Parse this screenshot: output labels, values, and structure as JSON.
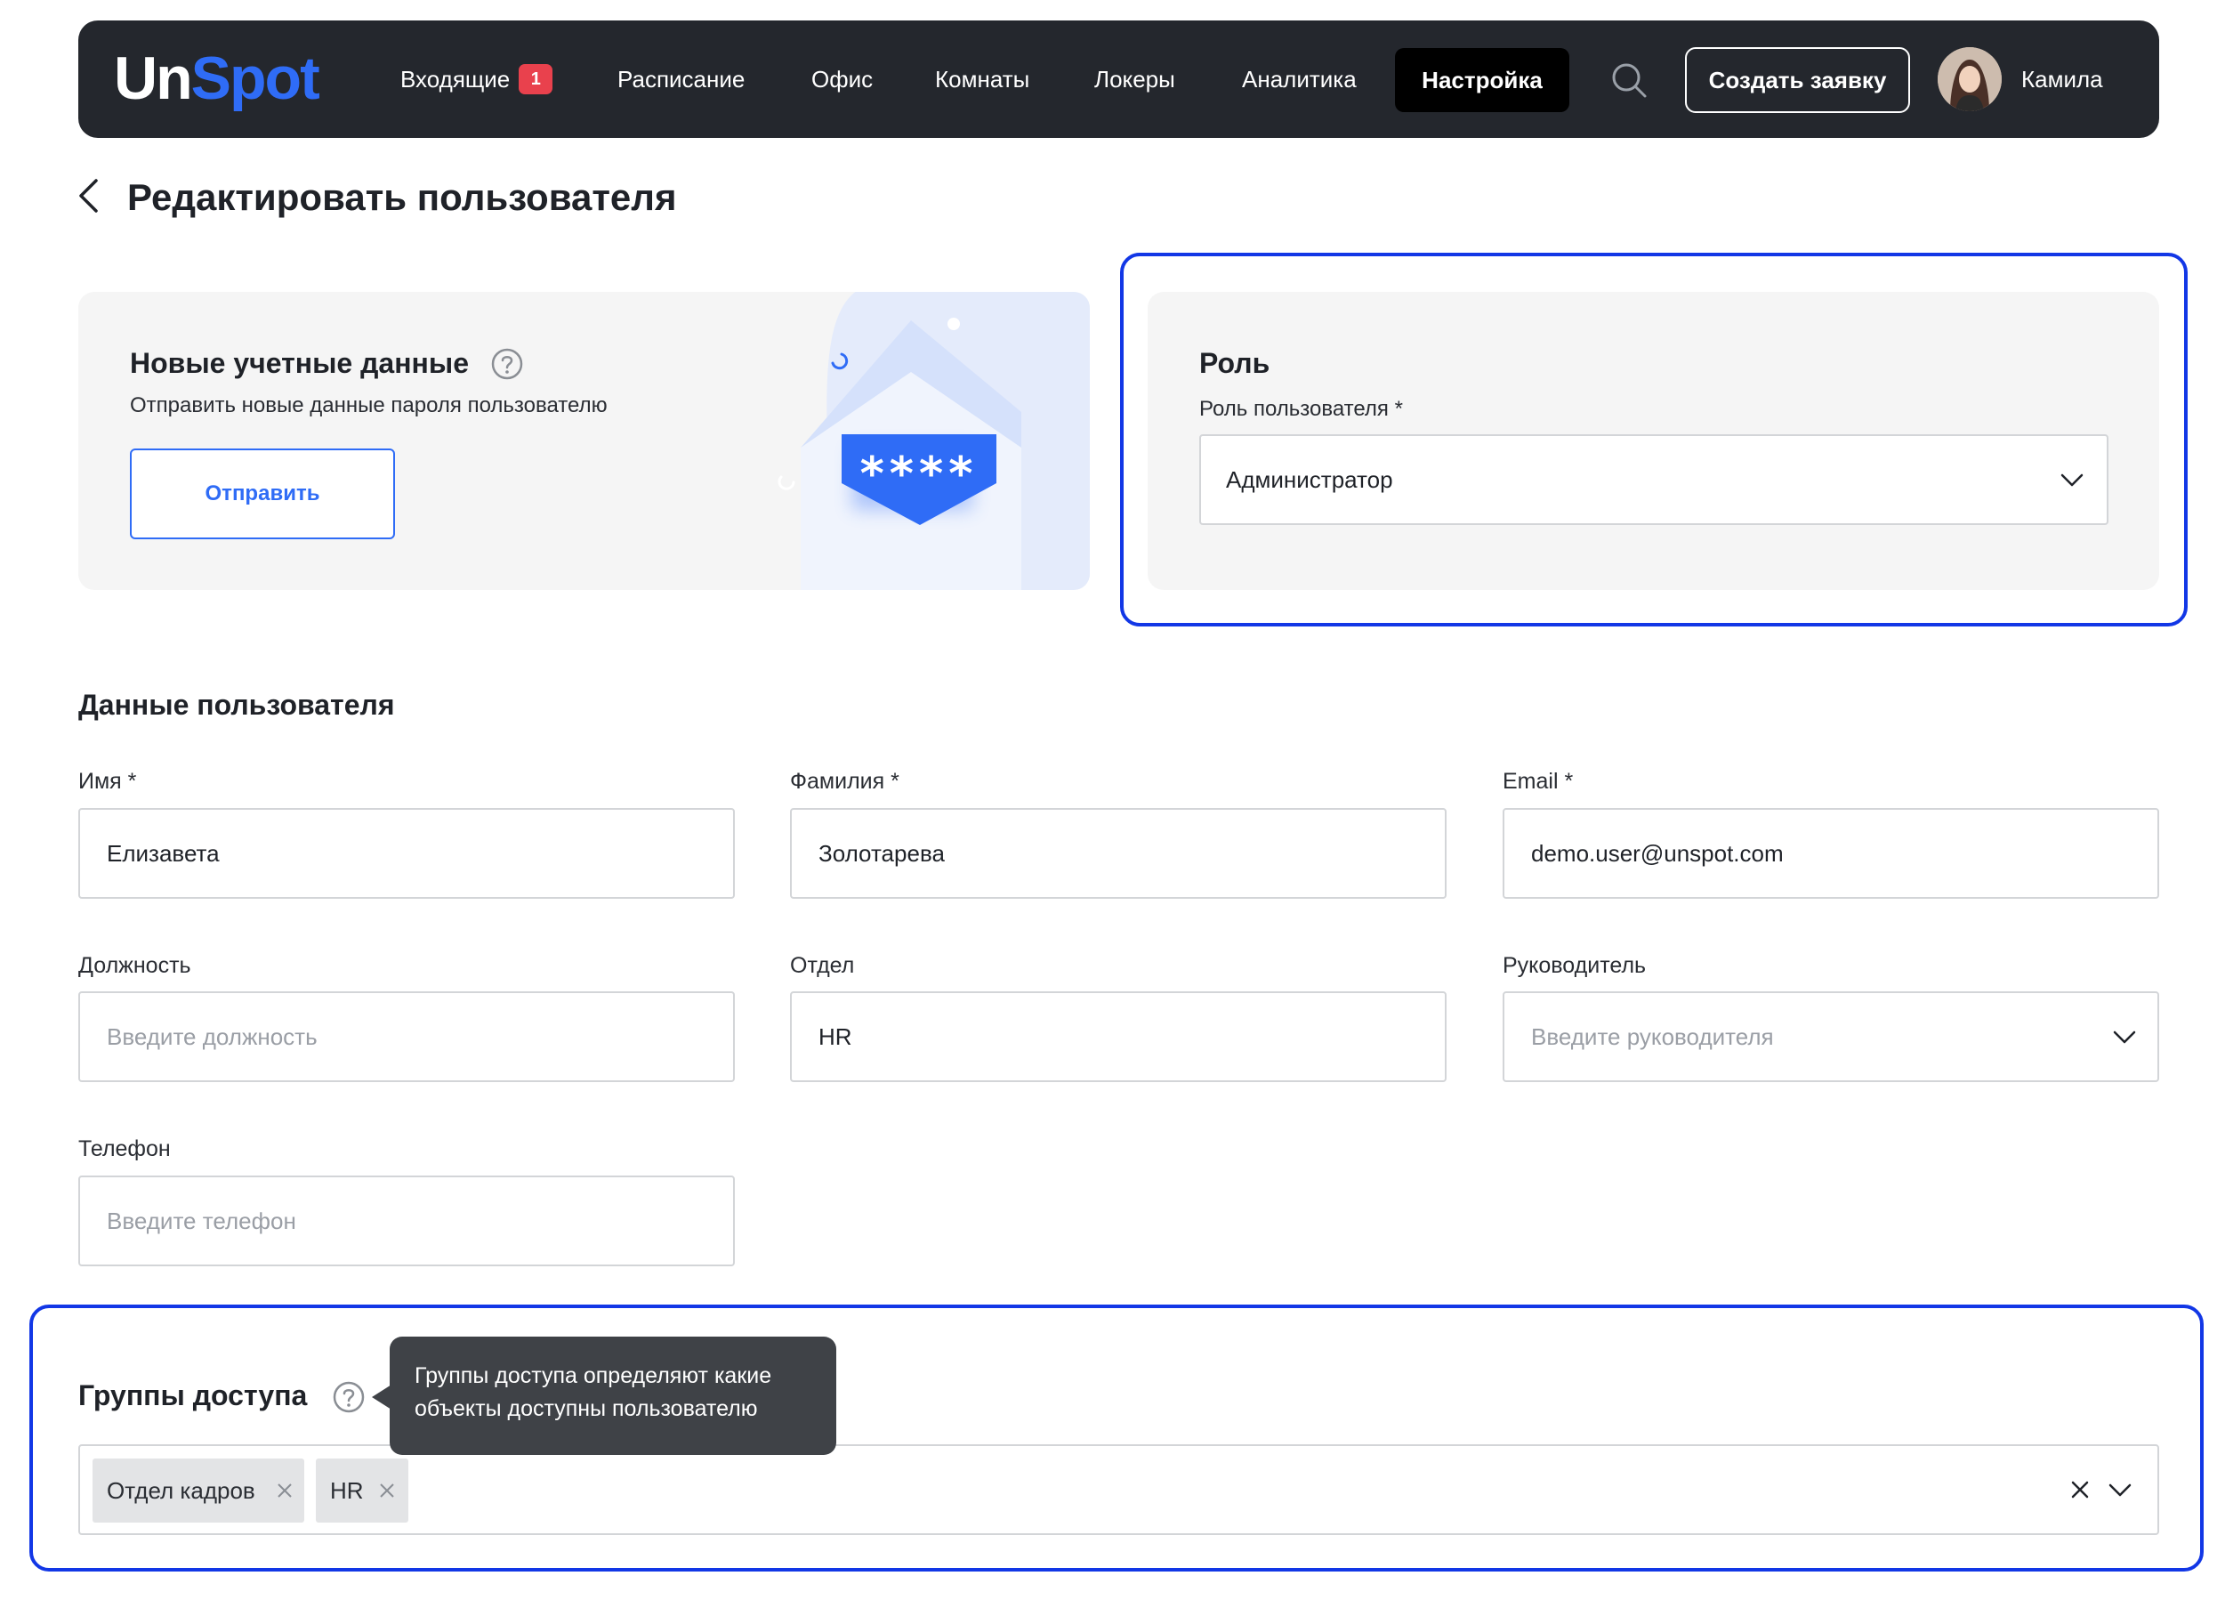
{
  "brand": {
    "logo_part1": "Un",
    "logo_part2": "Spot",
    "accent": "#2f6cf6",
    "highlight": "#1237e6"
  },
  "nav": {
    "inbox_label": "Входящие",
    "inbox_badge": "1",
    "schedule": "Расписание",
    "office": "Офис",
    "rooms": "Комнаты",
    "lockers": "Локеры",
    "analytics": "Аналитика",
    "settings": "Настройка",
    "create_request": "Создать заявку",
    "user_name": "Камила"
  },
  "page": {
    "title": "Редактировать пользователя"
  },
  "credentials": {
    "title": "Новые учетные данные",
    "subtitle": "Отправить новые данные пароля пользователю",
    "send_button": "Отправить",
    "mask": "****"
  },
  "role": {
    "title": "Роль",
    "label": "Роль пользователя *",
    "value": "Администратор"
  },
  "user_data": {
    "title": "Данные пользователя",
    "first_name": {
      "label": "Имя *",
      "value": "Елизавета"
    },
    "last_name": {
      "label": "Фамилия *",
      "value": "Золотарева"
    },
    "email": {
      "label": "Email *",
      "value": "demo.user@unspot.com"
    },
    "position": {
      "label": "Должность",
      "placeholder": "Введите должность"
    },
    "department": {
      "label": "Отдел",
      "value": "HR"
    },
    "manager": {
      "label": "Руководитель",
      "placeholder": "Введите руководителя"
    },
    "phone": {
      "label": "Телефон",
      "placeholder": "Введите телефон"
    }
  },
  "access_groups": {
    "title": "Группы доступа",
    "tooltip": "Группы доступа определяют какие объекты доступны пользователю",
    "tags": [
      "Отдел кадров",
      "HR"
    ]
  }
}
